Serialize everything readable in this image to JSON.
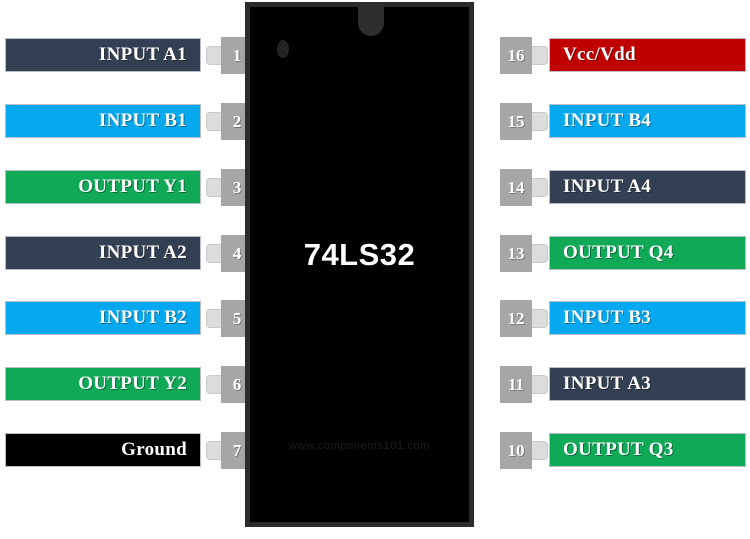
{
  "chip": {
    "part_number": "74LS32",
    "watermark": "www.components101.com",
    "body_color": "#000000",
    "notch_name": "chip-notch",
    "dot_name": "pin-one-dot"
  },
  "colors": {
    "input_a": "#333f52",
    "input_b": "#06a8ef",
    "output": "#0fa958",
    "power": "#c00000",
    "ground": "#000000",
    "pin_box": "#a6a6a6",
    "pin_tab": "#dcdcdc"
  },
  "left_pins": [
    {
      "number": "1",
      "label": "INPUT A1",
      "color": "#333f52"
    },
    {
      "number": "2",
      "label": "INPUT B1",
      "color": "#06a8ef"
    },
    {
      "number": "3",
      "label": "OUTPUT Y1",
      "color": "#0fa958"
    },
    {
      "number": "4",
      "label": "INPUT A2",
      "color": "#333f52"
    },
    {
      "number": "5",
      "label": "INPUT B2",
      "color": "#06a8ef"
    },
    {
      "number": "6",
      "label": "OUTPUT Y2",
      "color": "#0fa958"
    },
    {
      "number": "7",
      "label": "Ground",
      "color": "#000000"
    }
  ],
  "right_pins": [
    {
      "number": "16",
      "label": "Vcc/Vdd",
      "color": "#c00000"
    },
    {
      "number": "15",
      "label": "INPUT B4",
      "color": "#06a8ef"
    },
    {
      "number": "14",
      "label": "INPUT A4",
      "color": "#333f52"
    },
    {
      "number": "13",
      "label": "OUTPUT Q4",
      "color": "#0fa958"
    },
    {
      "number": "12",
      "label": "INPUT B3",
      "color": "#06a8ef"
    },
    {
      "number": "11",
      "label": "INPUT A3",
      "color": "#333f52"
    },
    {
      "number": "10",
      "label": "OUTPUT Q3",
      "color": "#0fa958"
    }
  ]
}
